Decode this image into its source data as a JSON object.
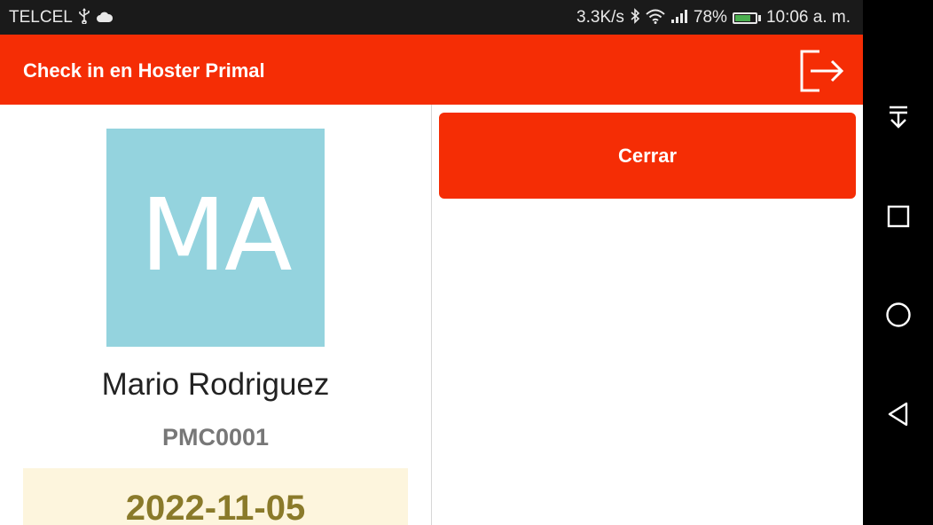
{
  "status_bar": {
    "carrier": "TELCEL",
    "network_speed": "3.3K/s",
    "battery_percent": "78%",
    "battery_level": 0.78,
    "time": "10:06 a. m."
  },
  "app_bar": {
    "title": "Check in en Hoster Primal",
    "logout_icon": "logout-icon"
  },
  "profile": {
    "initials": "MA",
    "name": "Mario Rodriguez",
    "code": "PMC0001",
    "date": "2022-11-05",
    "avatar_color": "#94d3de"
  },
  "actions": {
    "close_label": "Cerrar"
  },
  "colors": {
    "accent": "#f52d05",
    "date_background": "#fdf5dd",
    "date_text": "#8a7a2a"
  },
  "nav_bar": {
    "icons": [
      "notification-pull-icon",
      "recents-icon",
      "home-icon",
      "back-icon"
    ]
  }
}
